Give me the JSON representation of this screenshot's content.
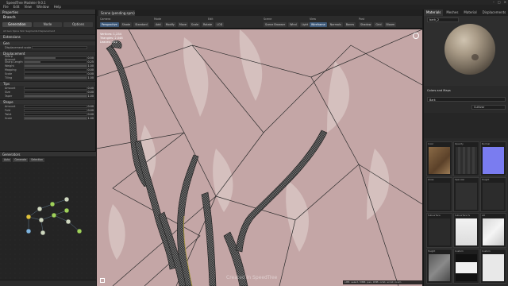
{
  "app": {
    "title": "SpeedTree Modeler 9.0.1"
  },
  "menu": [
    "File",
    "Edit",
    "View",
    "Window",
    "Help"
  ],
  "window_controls": [
    "–",
    "□",
    "✕"
  ],
  "left_panel": {
    "title": "Properties",
    "object_name": "Branch",
    "tabs": [
      "Generation",
      "Node",
      "Options"
    ],
    "sub_tabs": "All  Gen  Spine  Skin  Segments  Displacement",
    "section_gen": "Gen",
    "section_ext": "Extensions",
    "gen_row": "Displacement scale",
    "section_disp": "Displacement",
    "disp_rows": [
      {
        "label": "Sharp Amount",
        "value": "0.50",
        "fill": 0.5
      },
      {
        "label": "Sharp Length",
        "value": "0.25",
        "fill": 0.25
      },
      {
        "label": "Weight",
        "value": "1.00",
        "fill": 1.0
      },
      {
        "label": "Mapping",
        "value": "0.00",
        "fill": 0.0
      },
      {
        "label": "Scale",
        "value": "0.00",
        "fill": 0.0
      },
      {
        "label": "Tiling",
        "value": "1.00",
        "fill": 1.0
      }
    ],
    "section_tips": "Tips",
    "tips_rows": [
      {
        "label": "Amount",
        "value": "0.00",
        "fill": 0.0
      },
      {
        "label": "Size",
        "value": "0.00",
        "fill": 0.0
      },
      {
        "label": "Taper",
        "value": "1.00",
        "fill": 1.0
      }
    ],
    "section_shape": "Shape",
    "shape_rows": [
      {
        "label": "Amount",
        "value": "0.00",
        "fill": 0.0
      },
      {
        "label": "Fold",
        "value": "0.00",
        "fill": 0.0
      },
      {
        "label": "Twist",
        "value": "0.00",
        "fill": 0.0
      },
      {
        "label": "Scale",
        "value": "1.00",
        "fill": 1.0
      }
    ]
  },
  "node_view": {
    "title": "Generators",
    "buttons": [
      "Auto",
      "Generate",
      "Selection"
    ]
  },
  "viewport": {
    "tab": "Scene (pending.spm)",
    "groups": [
      "Camera",
      "Mode",
      "Edit",
      "Scene",
      "View",
      "Post"
    ],
    "tools": [
      [
        "Perspective",
        "Shade",
        "Standard"
      ],
      [
        "Add",
        "Modify",
        "Move",
        "Scale",
        "Rotate",
        "LOD"
      ],
      [
        "Scene Browser",
        "Wind",
        "Light"
      ],
      [
        "Wireframe",
        "Normals",
        "Bones"
      ],
      [
        "Shadow",
        "Grid",
        "Bloom"
      ]
    ],
    "hud": [
      "Vertices: 1,234",
      "Triangles: 2,048",
      "Leaves: 312"
    ],
    "watermark": "Created in SpeedTree",
    "status": "LMB: select, MMB: pan, RMB: orbit, scroll: zoom"
  },
  "right_panel": {
    "tabs": [
      "Materials",
      "Meshes",
      "Material Sets",
      "Displacements"
    ],
    "material_name": "bark_2",
    "section_label": "Colors and Maps",
    "map_row_left": "Bark",
    "map_row_right": "Cultivar",
    "grid_labels": [
      "Color",
      "Opacity",
      "Normal",
      "Gloss",
      "Specular",
      "Height",
      "Subsurface",
      "Subsurface %",
      "AO",
      "Height",
      "Custom",
      "Custom"
    ],
    "colors": {
      "bark_brown": "#7a5a3a",
      "normal_blue": "#7a7cf0",
      "leaf_pink": "#c7a9a9",
      "stem_dark": "#333333"
    }
  }
}
